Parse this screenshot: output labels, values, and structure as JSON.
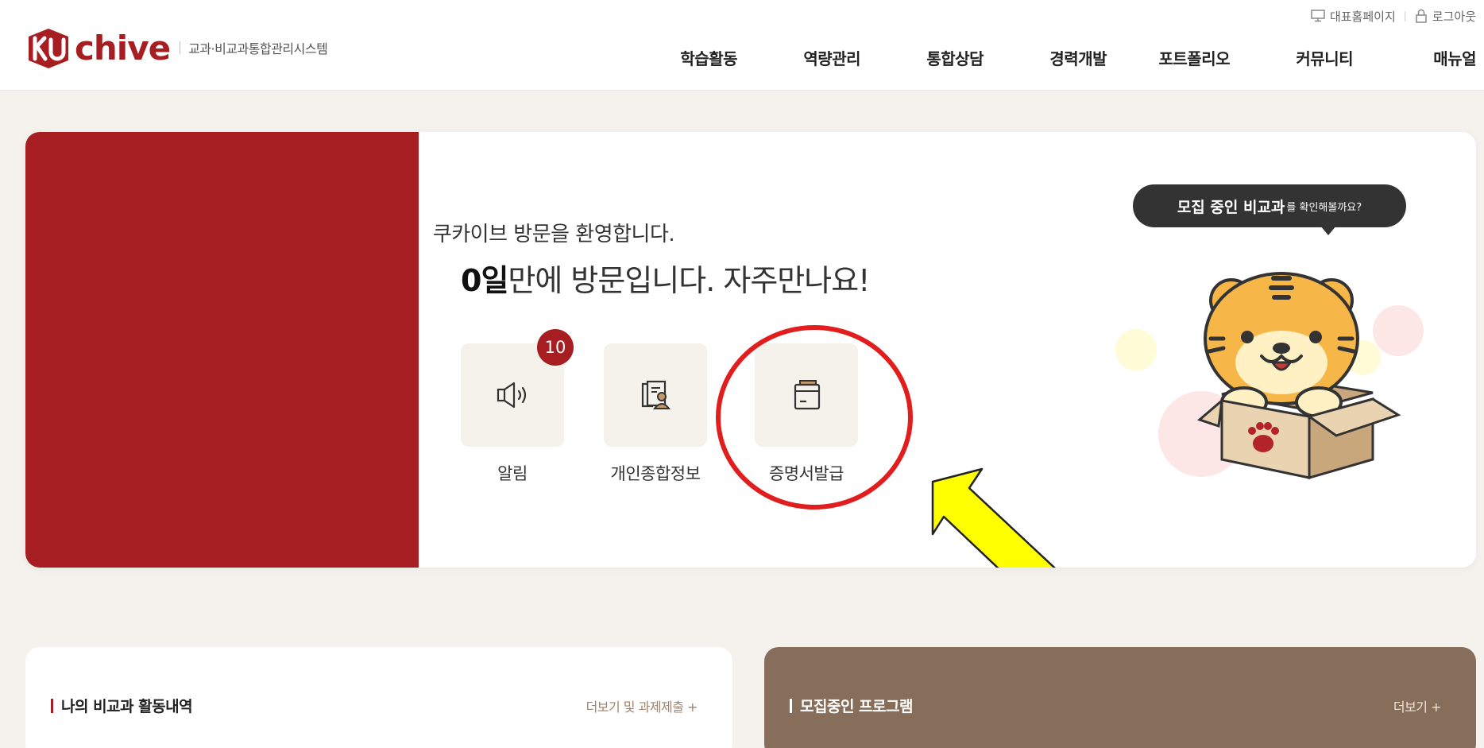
{
  "header": {
    "logo_text": "chive",
    "logo_subtitle": "교과·비교과통합관리시스템",
    "util_links": [
      {
        "label": "대표홈페이지",
        "icon": "monitor-icon"
      },
      {
        "label": "로그아웃",
        "icon": "lock-icon"
      }
    ],
    "nav": [
      "학습활동",
      "역량관리",
      "통합상담",
      "경력개발",
      "포트폴리오",
      "커뮤니티",
      "매뉴얼"
    ]
  },
  "hero": {
    "welcome_line1": "쿠카이브 방문을 환영합니다.",
    "days_value": "0일",
    "welcome_line2_rest": "만에 방문입니다. 자주만나요!",
    "quick_menu": [
      {
        "label": "알림",
        "icon": "speaker-icon",
        "badge": "10"
      },
      {
        "label": "개인종합정보",
        "icon": "profile-document-icon"
      },
      {
        "label": "증명서발급",
        "icon": "certificate-folder-icon"
      }
    ],
    "speech_bold": "모집 중인 비교과",
    "speech_rest": "를 확인해볼까요?"
  },
  "panels": {
    "left": {
      "title": "나의 비교과 활동내역",
      "more": "더보기 및 과제제출  +"
    },
    "right": {
      "title": "모집중인 프로그램",
      "more": "더보기  +"
    }
  },
  "colors": {
    "brand_red": "#a61e22",
    "panel_brown": "#866e5b",
    "annotation_red": "#e11d1d",
    "annotation_yellow": "#ffff00"
  }
}
